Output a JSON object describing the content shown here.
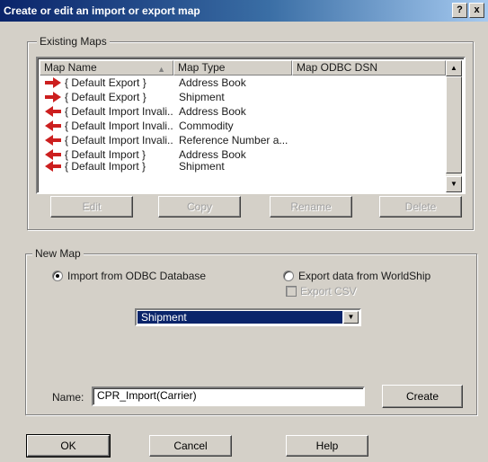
{
  "window": {
    "title": "Create or edit an import or export map",
    "help_button": "?",
    "close_button": "x"
  },
  "existing_maps": {
    "label": "Existing Maps",
    "columns": [
      "Map Name",
      "Map Type",
      "Map ODBC DSN"
    ],
    "rows": [
      {
        "name": "{ Default Export }",
        "type": "Address Book",
        "dsn": "",
        "direction": "export"
      },
      {
        "name": "{ Default Export }",
        "type": "Shipment",
        "dsn": "",
        "direction": "export"
      },
      {
        "name": "{ Default Import Invali...",
        "type": "Address Book",
        "dsn": "",
        "direction": "import"
      },
      {
        "name": "{ Default Import Invali...",
        "type": "Commodity",
        "dsn": "",
        "direction": "import"
      },
      {
        "name": "{ Default Import Invali...",
        "type": "Reference Number a...",
        "dsn": "",
        "direction": "import"
      },
      {
        "name": "{ Default Import }",
        "type": "Address Book",
        "dsn": "",
        "direction": "import"
      },
      {
        "name": "{ Default Import }",
        "type": "Shipment",
        "dsn": "",
        "direction": "import"
      }
    ],
    "buttons": {
      "edit": "Edit",
      "copy": "Copy",
      "rename": "Rename",
      "delete": "Delete"
    }
  },
  "new_map": {
    "label": "New Map",
    "import_option": "Import from ODBC Database",
    "export_option": "Export data from WorldShip",
    "export_csv": "Export CSV",
    "map_type_selected": "Shipment",
    "name_label": "Name:",
    "name_value": "CPR_Import(Carrier)",
    "create_button": "Create"
  },
  "footer": {
    "ok": "OK",
    "cancel": "Cancel",
    "help": "Help"
  },
  "colors": {
    "title_start": "#0a246a",
    "title_end": "#a6caf0",
    "dialog_bg": "#d4d0c8",
    "selection": "#0a246a",
    "arrow_icon": "#cc1f1f"
  }
}
